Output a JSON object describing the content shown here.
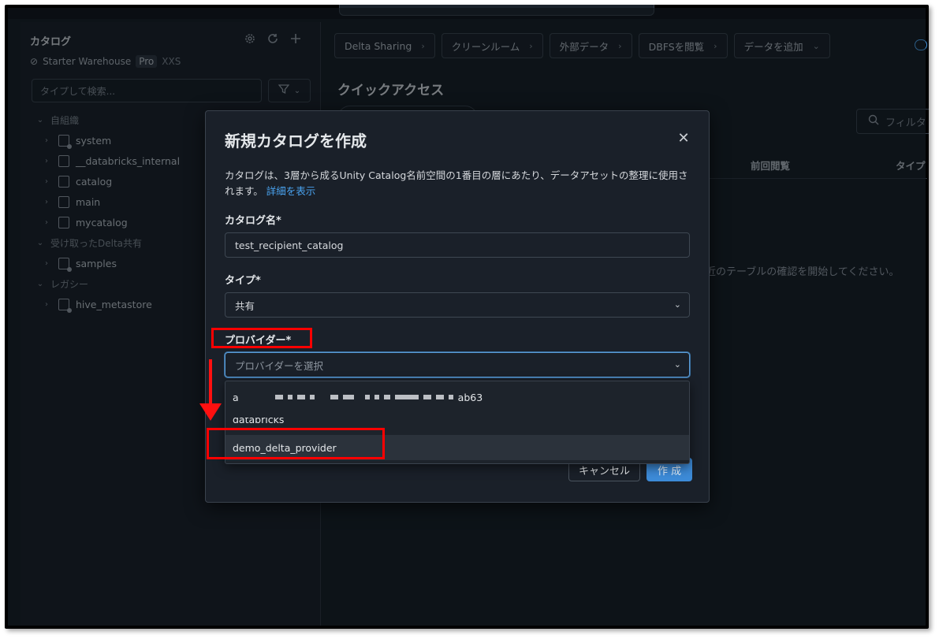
{
  "left_panel": {
    "title": "カタログ",
    "warehouse": {
      "name": "Starter Warehouse",
      "tier": "Pro",
      "size": "XXS"
    },
    "search_placeholder": "タイプして検索...",
    "tree": [
      {
        "type": "section",
        "label": "自組織"
      },
      {
        "type": "item",
        "label": "system"
      },
      {
        "type": "item",
        "label": "__databricks_internal"
      },
      {
        "type": "item",
        "label": "catalog"
      },
      {
        "type": "item",
        "label": "main"
      },
      {
        "type": "item",
        "label": "mycatalog"
      },
      {
        "type": "section",
        "label": "受け取ったDelta共有"
      },
      {
        "type": "item",
        "label": "samples"
      },
      {
        "type": "section",
        "label": "レガシー"
      },
      {
        "type": "item",
        "label": "hive_metastore"
      }
    ]
  },
  "main": {
    "toolbar": [
      "Delta Sharing",
      "クリーンルーム",
      "外部データ",
      "DBFSを閲覧",
      "データを追加"
    ],
    "quick_access_title": "クイックアクセス",
    "filter_placeholder": "フィルタ",
    "columns": [
      "前回閲覧",
      "タイプ"
    ],
    "empty_text": "最近のテーブルの確認を開始してください。"
  },
  "modal": {
    "title": "新規カタログを作成",
    "description": "カタログは、3層から成るUnity Catalog名前空間の1番目の層にあたり、データアセットの整理に使用されます。",
    "learn_more": "詳細を表示",
    "catalog_name_label": "カタログ名*",
    "catalog_name_value": "test_recipient_catalog",
    "type_label": "タイプ*",
    "type_value": "共有",
    "provider_label": "プロバイダー*",
    "provider_placeholder": "プロバイダーを選択",
    "provider_options": [
      "a",
      "ab63",
      "databricks",
      "demo_delta_provider"
    ],
    "cancel_label": "キャンセル",
    "create_label": "作 成"
  },
  "colors": {
    "background": "#131a22",
    "accent": "#3d8bd8",
    "link": "#4aa3f0",
    "annotation": "#ff0000"
  }
}
